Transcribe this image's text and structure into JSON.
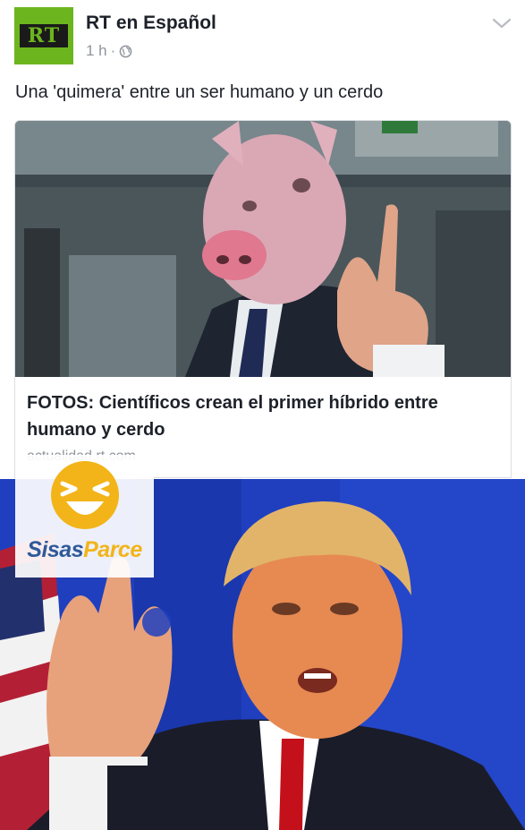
{
  "post": {
    "page_name": "RT en Español",
    "avatar_logo": "RT",
    "time": "1 h",
    "separator": "·",
    "caption": "Una 'quimera' entre un ser humano y un cerdo",
    "link": {
      "title": "FOTOS: Científicos crean el primer híbrido entre humano y cerdo",
      "domain": "actualidad.rt.com"
    }
  },
  "watermark": {
    "brand_part1": "Sisas",
    "brand_part2": "Parce"
  },
  "colors": {
    "rt_green": "#6db51e",
    "brand_blue": "#2f5a9a",
    "brand_yellow": "#f2b418",
    "meme_background": "#1f3fbf"
  }
}
